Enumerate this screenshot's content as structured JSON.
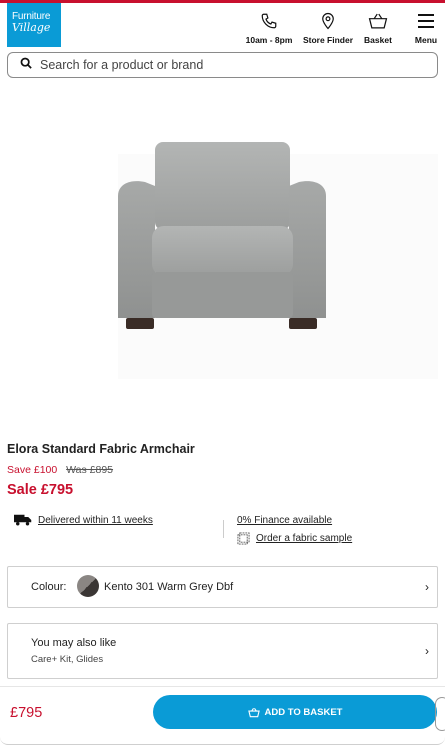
{
  "brand": {
    "line1": "Furniture",
    "line2": "Village",
    "color": "#0a9bd6"
  },
  "header": {
    "nav": [
      {
        "label": "10am - 8pm",
        "icon": "phone-icon"
      },
      {
        "label": "Store Finder",
        "icon": "map-pin-icon"
      },
      {
        "label": "Basket",
        "icon": "basket-icon"
      },
      {
        "label": "Menu",
        "icon": "hamburger-menu-icon"
      }
    ]
  },
  "search": {
    "placeholder": "Search for a product or brand"
  },
  "product": {
    "title": "Elora Standard Fabric Armchair",
    "save_text": "Save £100",
    "was_text": "Was £895",
    "sale_text": "Sale £795",
    "image_icon": "armchair-image"
  },
  "delivery": {
    "text": "Delivered within 11 weeks",
    "icon": "delivery-truck-icon"
  },
  "finance": {
    "text": "0% Finance available"
  },
  "sample": {
    "text": "Order a fabric sample",
    "icon": "fabric-sample-icon"
  },
  "colour": {
    "label": "Colour:",
    "value": "Kento 301 Warm Grey Dbf"
  },
  "also": {
    "title": "You may also like",
    "subtitle": "Care+ Kit, Glides"
  },
  "bottom": {
    "price": "£795",
    "button_label": "ADD TO BASKET"
  },
  "colors": {
    "sale_red": "#c8102e",
    "accent_blue": "#0a9bd6"
  }
}
